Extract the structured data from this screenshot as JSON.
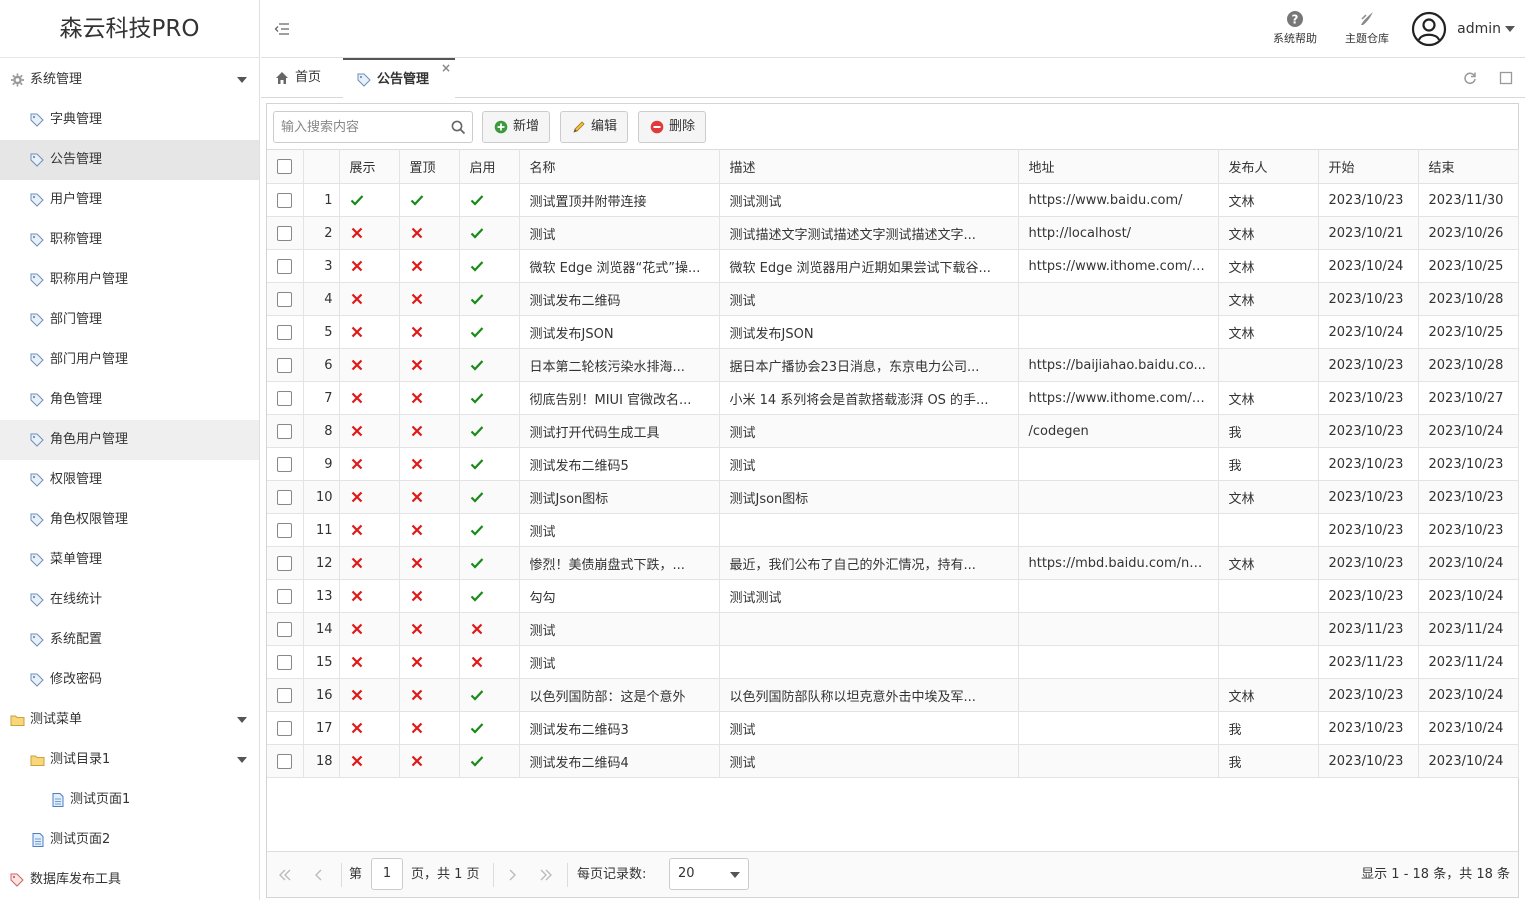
{
  "app": {
    "title": "森云科技PRO"
  },
  "header": {
    "help_label": "系统帮助",
    "theme_label": "主题仓库",
    "user_name": "admin"
  },
  "sidebar": {
    "items": [
      {
        "label": "系统管理",
        "level": 0,
        "icon": "gear-icon",
        "expandable": true
      },
      {
        "label": "字典管理",
        "level": 1,
        "icon": "tag-icon"
      },
      {
        "label": "公告管理",
        "level": 1,
        "icon": "tag-icon",
        "selected": true
      },
      {
        "label": "用户管理",
        "level": 1,
        "icon": "tag-icon"
      },
      {
        "label": "职称管理",
        "level": 1,
        "icon": "tag-icon"
      },
      {
        "label": "职称用户管理",
        "level": 1,
        "icon": "tag-icon"
      },
      {
        "label": "部门管理",
        "level": 1,
        "icon": "tag-icon"
      },
      {
        "label": "部门用户管理",
        "level": 1,
        "icon": "tag-icon"
      },
      {
        "label": "角色管理",
        "level": 1,
        "icon": "tag-icon"
      },
      {
        "label": "角色用户管理",
        "level": 1,
        "icon": "tag-icon",
        "hover": true
      },
      {
        "label": "权限管理",
        "level": 1,
        "icon": "tag-icon"
      },
      {
        "label": "角色权限管理",
        "level": 1,
        "icon": "tag-icon"
      },
      {
        "label": "菜单管理",
        "level": 1,
        "icon": "tag-icon"
      },
      {
        "label": "在线统计",
        "level": 1,
        "icon": "tag-icon"
      },
      {
        "label": "系统配置",
        "level": 1,
        "icon": "tag-icon"
      },
      {
        "label": "修改密码",
        "level": 1,
        "icon": "tag-icon"
      },
      {
        "label": "测试菜单",
        "level": 0,
        "icon": "folder-icon",
        "expandable": true
      },
      {
        "label": "测试目录1",
        "level": 1,
        "icon": "folder-icon",
        "expandable": true
      },
      {
        "label": "测试页面1",
        "level": 2,
        "icon": "page-icon"
      },
      {
        "label": "测试页面2",
        "level": 1,
        "icon": "page-icon"
      },
      {
        "label": "数据库发布工具",
        "level": 0,
        "icon": "tag-red-icon"
      }
    ]
  },
  "tabs": [
    {
      "label": "首页",
      "icon": "home-icon"
    },
    {
      "label": "公告管理",
      "icon": "tag-icon",
      "active": true,
      "close": "×"
    }
  ],
  "toolbar": {
    "search_placeholder": "输入搜索内容",
    "add_label": "新增",
    "edit_label": "编辑",
    "delete_label": "删除"
  },
  "table": {
    "columns": [
      "展示",
      "置顶",
      "启用",
      "名称",
      "描述",
      "地址",
      "发布人",
      "开始",
      "结束"
    ],
    "rows": [
      {
        "no": "1",
        "show": true,
        "top": true,
        "enabled": true,
        "name": "测试置顶并附带连接",
        "desc": "测试测试",
        "url": "https://www.baidu.com/",
        "publisher": "文林",
        "start": "2023/10/23",
        "end": "2023/11/30"
      },
      {
        "no": "2",
        "show": false,
        "top": false,
        "enabled": true,
        "name": "测试",
        "desc": "测试描述文字测试描述文字测试描述文字...",
        "url": "http://localhost/",
        "publisher": "文林",
        "start": "2023/10/21",
        "end": "2023/10/26"
      },
      {
        "no": "3",
        "show": false,
        "top": false,
        "enabled": true,
        "name": "微软 Edge 浏览器“花式”操...",
        "desc": "微软 Edge 浏览器用户近期如果尝试下载谷...",
        "url": "https://www.ithome.com/0/...",
        "publisher": "文林",
        "start": "2023/10/24",
        "end": "2023/10/25"
      },
      {
        "no": "4",
        "show": false,
        "top": false,
        "enabled": true,
        "name": "测试发布二维码",
        "desc": "测试",
        "url": "",
        "publisher": "文林",
        "start": "2023/10/23",
        "end": "2023/10/28"
      },
      {
        "no": "5",
        "show": false,
        "top": false,
        "enabled": true,
        "name": "测试发布JSON",
        "desc": "测试发布JSON",
        "url": "",
        "publisher": "文林",
        "start": "2023/10/24",
        "end": "2023/10/25"
      },
      {
        "no": "6",
        "show": false,
        "top": false,
        "enabled": true,
        "name": "日本第二轮核污染水排海...",
        "desc": "据日本广播协会23日消息，东京电力公司...",
        "url": "https://baijiahao.baidu.co...",
        "publisher": "",
        "start": "2023/10/23",
        "end": "2023/10/28"
      },
      {
        "no": "7",
        "show": false,
        "top": false,
        "enabled": true,
        "name": "彻底告别！MIUI 官微改名...",
        "desc": "小米 14 系列将会是首款搭载澎湃 OS 的手...",
        "url": "https://www.ithome.com/0/...",
        "publisher": "文林",
        "start": "2023/10/23",
        "end": "2023/10/27"
      },
      {
        "no": "8",
        "show": false,
        "top": false,
        "enabled": true,
        "name": "测试打开代码生成工具",
        "desc": "测试",
        "url": "/codegen",
        "publisher": "我",
        "start": "2023/10/23",
        "end": "2023/10/24"
      },
      {
        "no": "9",
        "show": false,
        "top": false,
        "enabled": true,
        "name": "测试发布二维码5",
        "desc": "测试",
        "url": "",
        "publisher": "我",
        "start": "2023/10/23",
        "end": "2023/10/23"
      },
      {
        "no": "10",
        "show": false,
        "top": false,
        "enabled": true,
        "name": "测试Json图标",
        "desc": "测试Json图标",
        "url": "",
        "publisher": "文林",
        "start": "2023/10/23",
        "end": "2023/10/23"
      },
      {
        "no": "11",
        "show": false,
        "top": false,
        "enabled": true,
        "name": "测试",
        "desc": "",
        "url": "",
        "publisher": "",
        "start": "2023/10/23",
        "end": "2023/10/23"
      },
      {
        "no": "12",
        "show": false,
        "top": false,
        "enabled": true,
        "name": "惨烈！美债崩盘式下跌，...",
        "desc": "最近，我们公布了自己的外汇情况，持有...",
        "url": "https://mbd.baidu.com/ne...",
        "publisher": "文林",
        "start": "2023/10/23",
        "end": "2023/10/24"
      },
      {
        "no": "13",
        "show": false,
        "top": false,
        "enabled": true,
        "name": "勾勾",
        "desc": "测试测试",
        "url": "",
        "publisher": "",
        "start": "2023/10/23",
        "end": "2023/10/24"
      },
      {
        "no": "14",
        "show": false,
        "top": false,
        "enabled": false,
        "name": "测试",
        "desc": "",
        "url": "",
        "publisher": "",
        "start": "2023/11/23",
        "end": "2023/11/24"
      },
      {
        "no": "15",
        "show": false,
        "top": false,
        "enabled": false,
        "name": "测试",
        "desc": "",
        "url": "",
        "publisher": "",
        "start": "2023/11/23",
        "end": "2023/11/24"
      },
      {
        "no": "16",
        "show": false,
        "top": false,
        "enabled": true,
        "name": "以色列国防部：这是个意外",
        "desc": "以色列国防部队称以坦克意外击中埃及军...",
        "url": "",
        "publisher": "文林",
        "start": "2023/10/23",
        "end": "2023/10/24"
      },
      {
        "no": "17",
        "show": false,
        "top": false,
        "enabled": true,
        "name": "测试发布二维码3",
        "desc": "测试",
        "url": "",
        "publisher": "我",
        "start": "2023/10/23",
        "end": "2023/10/24"
      },
      {
        "no": "18",
        "show": false,
        "top": false,
        "enabled": true,
        "name": "测试发布二维码4",
        "desc": "测试",
        "url": "",
        "publisher": "我",
        "start": "2023/10/23",
        "end": "2023/10/24"
      }
    ]
  },
  "pager": {
    "page_prefix": "第",
    "page_value": "1",
    "page_suffix": "页，共 1 页",
    "page_size_label": "每页记录数:",
    "page_size": "20",
    "summary": "显示 1 - 18 条，共 18 条"
  },
  "colors": {
    "check": "#1a8a1a",
    "cross": "#e01818",
    "selected_bg": "#e6e6e6"
  }
}
